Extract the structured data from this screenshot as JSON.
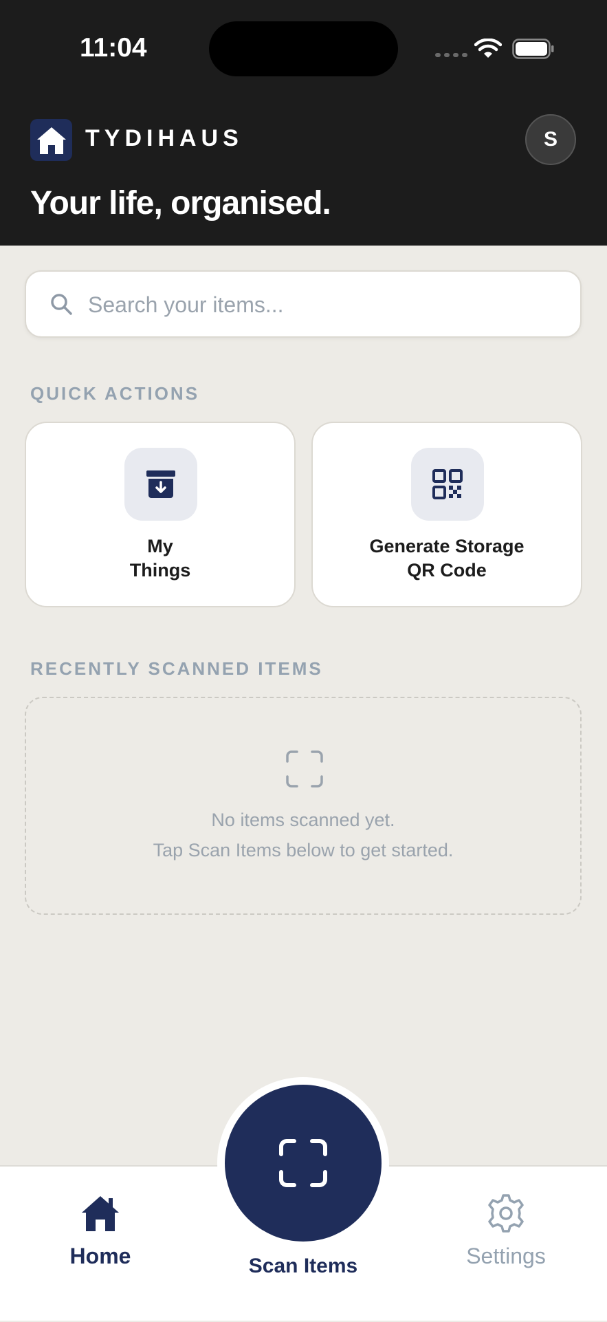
{
  "status_bar": {
    "time": "11:04"
  },
  "header": {
    "brand": "TYDIHAUS",
    "avatar_initial": "S",
    "tagline": "Your life, organised."
  },
  "search": {
    "placeholder": "Search your items..."
  },
  "quick_actions": {
    "label": "QUICK ACTIONS",
    "items": [
      {
        "label": "My\nThings",
        "icon": "archive-icon"
      },
      {
        "label": "Generate Storage\nQR Code",
        "icon": "qr-code-icon"
      }
    ]
  },
  "recent": {
    "label": "RECENTLY SCANNED ITEMS",
    "empty_line1": "No items scanned yet.",
    "empty_line2": "Tap Scan Items below to get started."
  },
  "nav": {
    "home": "Home",
    "scan": "Scan Items",
    "settings": "Settings"
  },
  "colors": {
    "accent": "#1f2d5a",
    "header_bg": "#1c1c1c",
    "page_bg": "#edebe6",
    "muted": "#94a2b0"
  }
}
